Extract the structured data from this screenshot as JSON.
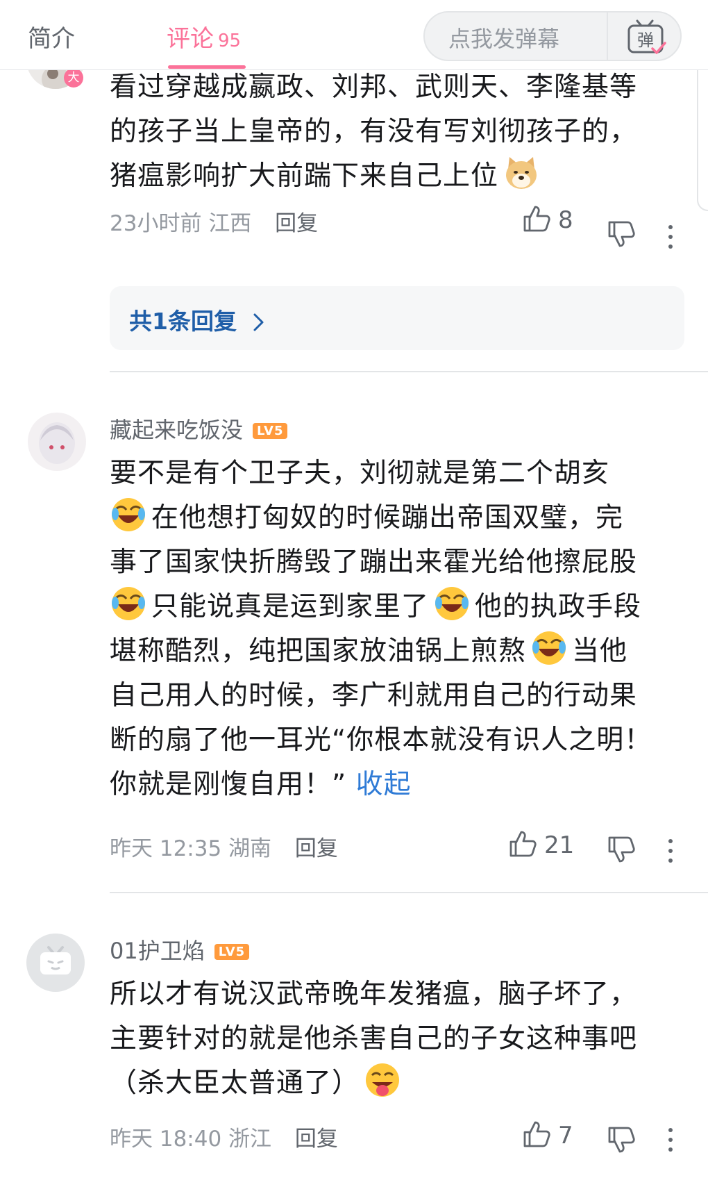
{
  "tabs": {
    "intro": "简介",
    "comments": "评论",
    "comments_count": "95"
  },
  "danmaku": {
    "placeholder": "点我发弹幕",
    "button_label": "弹"
  },
  "comments": [
    {
      "username": "",
      "level": "",
      "badge": "大",
      "text_lines": [
        "看过穿越成嬴政、刘邦、武则天、李隆基等",
        "的孩子当上皇帝的，有没有写刘彻孩子的，",
        "猪瘟影响扩大前踹下来自己上位"
      ],
      "emojis": [
        "doge-emoji"
      ],
      "time": "23小时前",
      "location": "江西",
      "reply_label": "回复",
      "likes": "8",
      "replies_summary": "共1条回复"
    },
    {
      "username": "藏起来吃饭没",
      "level": "LV5",
      "text_segments": [
        "要不是有个卫子夫，刘彻就是第二个胡亥",
        "在他想打匈奴的时候蹦出帝国双璧，完",
        "事了国家快折腾毁了蹦出来霍光给他擦屁股",
        "只能说真是运到家里了",
        "他的执政手段",
        "堪称酷烈，纯把国家放油锅上煎熬",
        "当他",
        "自己用人的时候，李广利就用自己的行动果",
        "断的扇了他一耳光“你根本就没有识人之明！",
        "你就是刚愎自用！”"
      ],
      "expand_label": "收起",
      "emojis": [
        "laugh-cry-emoji"
      ],
      "time": "昨天 12:35",
      "location": "湖南",
      "reply_label": "回复",
      "likes": "21"
    },
    {
      "username": "01护卫焰",
      "level": "LV5",
      "text_lines": [
        "所以才有说汉武帝晚年发猪瘟，脑子坏了，",
        "主要针对的就是他杀害自己的子女这种事吧",
        "（杀大臣太普通了）"
      ],
      "emojis": [
        "tongue-emoji"
      ],
      "time": "昨天 18:40",
      "location": "浙江",
      "reply_label": "回复",
      "likes": "7"
    }
  ],
  "colors": {
    "accent_pink": "#fb7299",
    "link_blue": "#2f7bd6",
    "meta_gray": "#9499a0",
    "level_orange": "#ff9a3c"
  }
}
